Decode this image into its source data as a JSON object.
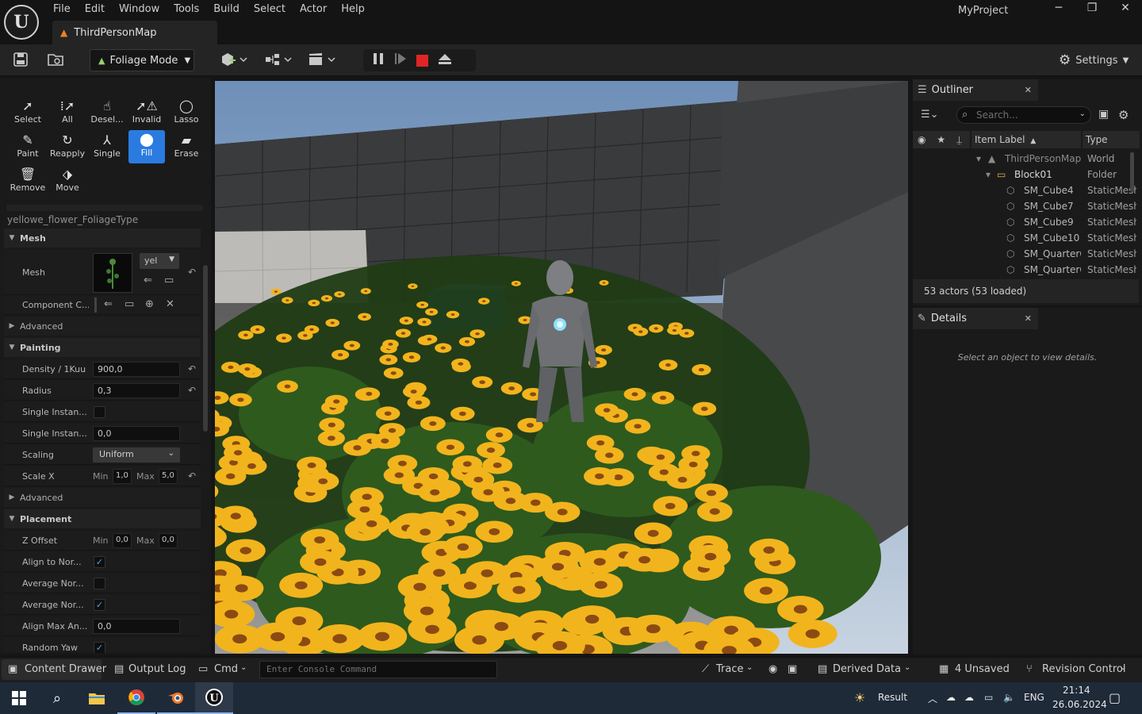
{
  "window": {
    "project_name": "MyProject",
    "menu": [
      "File",
      "Edit",
      "Window",
      "Tools",
      "Build",
      "Select",
      "Actor",
      "Help"
    ],
    "map_tab": "ThirdPersonMap",
    "controls": {
      "minimize": "─",
      "restore": "❐",
      "close": "✕"
    }
  },
  "toolbar": {
    "mode_label": "Foliage Mode",
    "settings_label": "Settings"
  },
  "foliage_tools": [
    {
      "label": "Select",
      "icon": "cursor-icon"
    },
    {
      "label": "All",
      "icon": "select-all-icon"
    },
    {
      "label": "Desel...",
      "icon": "deselect-icon"
    },
    {
      "label": "Invalid",
      "icon": "invalid-icon"
    },
    {
      "label": "Lasso",
      "icon": "lasso-icon"
    },
    {
      "label": "Paint",
      "icon": "brush-icon"
    },
    {
      "label": "Reapply",
      "icon": "reapply-icon"
    },
    {
      "label": "Single",
      "icon": "single-icon"
    },
    {
      "label": "Fill",
      "icon": "fill-icon",
      "active": true
    },
    {
      "label": "Erase",
      "icon": "erase-icon"
    },
    {
      "label": "Remove",
      "icon": "trash-icon"
    },
    {
      "label": "Move",
      "icon": "move-icon"
    }
  ],
  "details_left": {
    "foliage_type": "yellowe_flower_FoliageType",
    "sections": {
      "mesh": "Mesh",
      "advanced": "Advanced",
      "painting": "Painting",
      "placement": "Placement"
    },
    "mesh": {
      "label": "Mesh",
      "dropdown": "yel"
    },
    "component_class_label": "Component C...",
    "props": {
      "density": {
        "label": "Density / 1Kuu",
        "value": "900,0"
      },
      "radius": {
        "label": "Radius",
        "value": "0,3"
      },
      "single_instance_check": {
        "label": "Single Instan..."
      },
      "single_instance_val": {
        "label": "Single Instan...",
        "value": "0,0"
      },
      "scaling": {
        "label": "Scaling",
        "value": "Uniform"
      },
      "scale_x": {
        "label": "Scale X",
        "min_label": "Min",
        "min": "1,0",
        "max_label": "Max",
        "max": "5,0"
      },
      "z_offset": {
        "label": "Z Offset",
        "min_label": "Min",
        "min": "0,0",
        "max_label": "Max",
        "max": "0,0"
      },
      "align_to_normal": {
        "label": "Align to Nor...",
        "checked": true
      },
      "average_normal_1": {
        "label": "Average Nor...",
        "checked": false
      },
      "average_normal_2": {
        "label": "Average Nor...",
        "checked": true
      },
      "align_max_angle": {
        "label": "Align Max An...",
        "value": "0,0"
      },
      "random_yaw": {
        "label": "Random Yaw",
        "checked": true
      }
    }
  },
  "outliner": {
    "title": "Outliner",
    "search_placeholder": "Search...",
    "col_label": "Item Label",
    "col_type": "Type",
    "rows": [
      {
        "name": "ThirdPersonMap",
        "type": "World"
      },
      {
        "name": "Block01",
        "type": "Folder"
      },
      {
        "name": "SM_Cube4",
        "type": "StaticMesh"
      },
      {
        "name": "SM_Cube7",
        "type": "StaticMesh"
      },
      {
        "name": "SM_Cube9",
        "type": "StaticMesh"
      },
      {
        "name": "SM_Cube10",
        "type": "StaticMesh"
      },
      {
        "name": "SM_QuarterC",
        "type": "StaticMesh"
      },
      {
        "name": "SM_QuarterC",
        "type": "StaticMesh"
      }
    ],
    "actor_count": "53 actors (53 loaded)"
  },
  "details_panel": {
    "title": "Details",
    "empty_text": "Select an object to view details."
  },
  "statusbar": {
    "content_drawer": "Content Drawer",
    "output_log": "Output Log",
    "cmd": "Cmd",
    "console_placeholder": "Enter Console Command",
    "trace": "Trace",
    "derived_data": "Derived Data",
    "unsaved": "4 Unsaved",
    "revision_control": "Revision Control"
  },
  "taskbar": {
    "weather": "Result",
    "lang": "ENG",
    "time": "21:14",
    "date": "26.06.2024"
  },
  "colors": {
    "accent": "#2a7be0",
    "stop": "#e02525",
    "flower": "#f2b41c",
    "mode_icon": "#9ad070"
  }
}
